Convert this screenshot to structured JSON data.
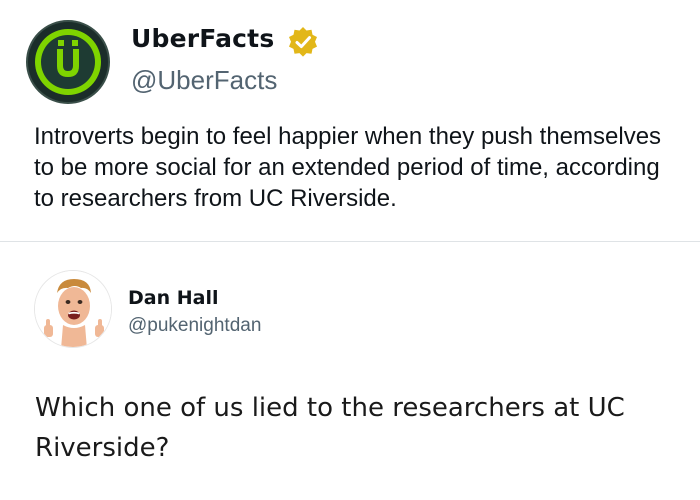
{
  "tweets": [
    {
      "display_name": "UberFacts",
      "handle": "@UberFacts",
      "verified": true,
      "avatar_icon": "uberfacts-logo-icon",
      "text": "Introverts begin to feel happier when they push themselves to be more social for an extended period of time, according to researchers from UC Riverside."
    },
    {
      "display_name": "Dan Hall",
      "handle": "@pukenightdan",
      "verified": false,
      "avatar_icon": "profile-photo-icon",
      "text": "Which one of us lied to the researchers at UC Riverside?"
    }
  ],
  "colors": {
    "logo_green": "#7fd400",
    "logo_dark": "#1e3b33",
    "verified_gold": "#e2b719",
    "handle_gray": "#536471",
    "divider": "#dfe3e6"
  }
}
